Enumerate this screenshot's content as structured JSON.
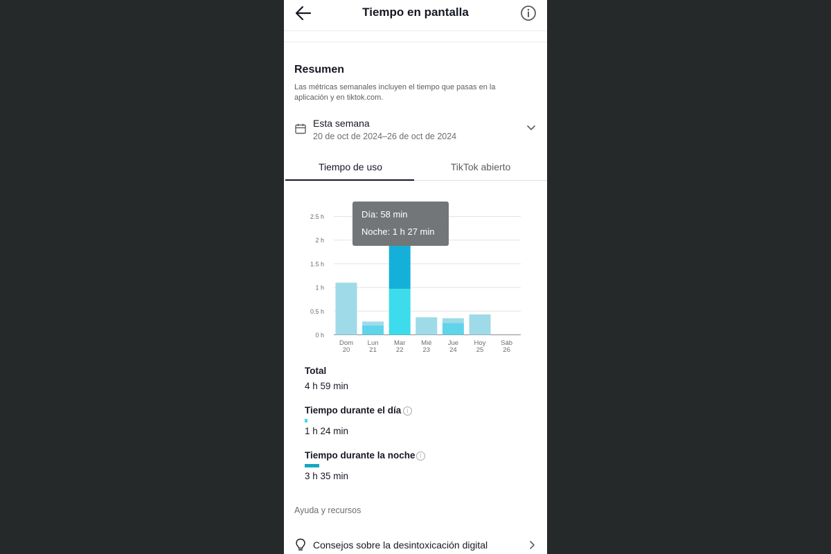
{
  "header": {
    "title": "Tiempo en pantalla",
    "back_icon": "arrow-left-icon",
    "info_icon": "info-icon"
  },
  "summary": {
    "title": "Resumen",
    "description": "Las métricas semanales incluyen el tiempo que pasas en la aplicación y en tiktok.com."
  },
  "range": {
    "label": "Esta semana",
    "dates": "20 de oct de 2024–26 de oct de 2024",
    "icon": "calendar-icon",
    "chevron_icon": "chevron-down-icon"
  },
  "tabs": [
    {
      "label": "Tiempo de uso",
      "active": true
    },
    {
      "label": "TikTok abierto",
      "active": false
    }
  ],
  "tooltip": {
    "day": "Día: 58 min",
    "night": "Noche:  1 h 27 min"
  },
  "chart_data": {
    "type": "bar",
    "stacked": true,
    "categories": [
      {
        "day": "Dom",
        "date": "20"
      },
      {
        "day": "Lun",
        "date": "21"
      },
      {
        "day": "Mar",
        "date": "22"
      },
      {
        "day": "Mié",
        "date": "23"
      },
      {
        "day": "Jue",
        "date": "24"
      },
      {
        "day": "Hoy",
        "date": "25"
      },
      {
        "day": "Sáb",
        "date": "26"
      }
    ],
    "series": [
      {
        "values": [
          0,
          0.2,
          0.97,
          0,
          0.25,
          0,
          0
        ]
      },
      {
        "values": [
          1.1,
          0.08,
          1.45,
          0.37,
          0.1,
          0.43,
          0
        ]
      }
    ],
    "highlight_index": 2,
    "yticks": [
      "0 h",
      "0.5 h",
      "1 h",
      "1.5 h",
      "2 h",
      "2.5 h"
    ],
    "ylim": [
      0,
      2.5
    ],
    "grid": true,
    "colors": {
      "day_active": "#3cdcec",
      "night_active": "#15b0d9",
      "day_inactive": "#60d4ea",
      "night_inactive": "#9fdae8",
      "grid": "#e3e3e3",
      "tick": "#6b6c70"
    }
  },
  "stats": {
    "total_label": "Total",
    "total_value": "4 h 59 min",
    "day_label": "Tiempo durante el día",
    "day_value": "1 h 24 min",
    "night_label": "Tiempo durante la noche",
    "night_value": "3 h 35 min",
    "day_color": "#3cdcec",
    "night_color": "#15a6c4",
    "info_icon": "info-circle-icon"
  },
  "help": {
    "title": "Ayuda y recursos",
    "tips_label": "Consejos sobre la desintoxicación digital",
    "tips_icon": "lightbulb-icon",
    "chevron_icon": "chevron-right-icon"
  }
}
